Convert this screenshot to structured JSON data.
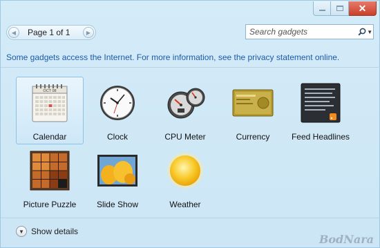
{
  "window": {
    "controls": [
      {
        "name": "minimize-button",
        "icon": "minimize-icon"
      },
      {
        "name": "maximize-button",
        "icon": "maximize-icon"
      },
      {
        "name": "close-button",
        "icon": "close-icon",
        "glyph": "✕"
      }
    ]
  },
  "toolbar": {
    "page_label": "Page 1 of 1",
    "prev_icon": "chevron-left-icon",
    "next_icon": "chevron-right-icon",
    "search_placeholder": "Search gadgets",
    "search_icon": "search-icon",
    "search_dropdown_icon": "chevron-down-icon"
  },
  "notice": "Some gadgets access the Internet.  For more information, see the privacy statement online.",
  "gadgets": [
    {
      "label": "Calendar",
      "icon": "calendar-icon",
      "selected": true
    },
    {
      "label": "Clock",
      "icon": "clock-icon",
      "selected": false
    },
    {
      "label": "CPU Meter",
      "icon": "cpu-meter-icon",
      "selected": false
    },
    {
      "label": "Currency",
      "icon": "currency-icon",
      "selected": false
    },
    {
      "label": "Feed Headlines",
      "icon": "feed-headlines-icon",
      "selected": false
    },
    {
      "label": "Picture Puzzle",
      "icon": "picture-puzzle-icon",
      "selected": false
    },
    {
      "label": "Slide Show",
      "icon": "slide-show-icon",
      "selected": false
    },
    {
      "label": "Weather",
      "icon": "weather-icon",
      "selected": false
    }
  ],
  "calendar_month": "OCT 08",
  "footer": {
    "show_details_label": "Show details",
    "expand_icon": "chevron-down-icon"
  },
  "watermark": "BodNara",
  "colors": {
    "link_blue": "#1a5aa8",
    "window_bg": "#cce6f5",
    "selected_tile": "#cde7f8",
    "close_red": "#c8402a"
  }
}
